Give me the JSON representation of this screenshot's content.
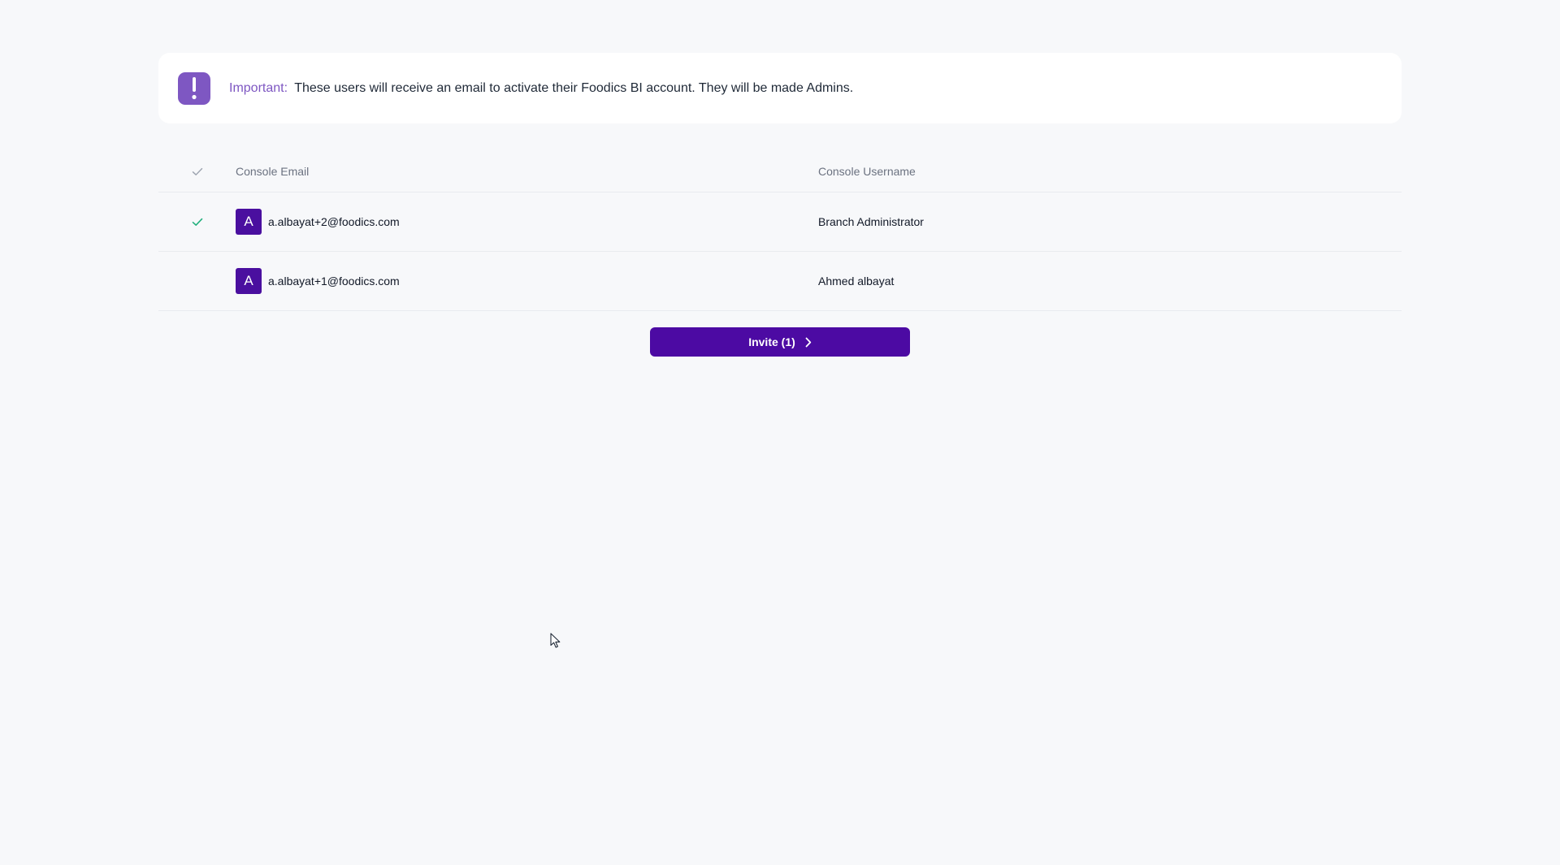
{
  "notice": {
    "icon": "exclamation-icon",
    "label": "Important:",
    "message": "These users will receive an email to activate their Foodics BI account. They will be made Admins."
  },
  "table": {
    "headers": {
      "email": "Console Email",
      "username": "Console Username"
    },
    "rows": [
      {
        "selected": true,
        "avatar_letter": "A",
        "email": "a.albayat+2@foodics.com",
        "username": "Branch Administrator"
      },
      {
        "selected": false,
        "avatar_letter": "A",
        "email": "a.albayat+1@foodics.com",
        "username": "Ahmed albayat"
      }
    ]
  },
  "invite_button": {
    "label": "Invite (1)",
    "icon": "chevron-right-icon"
  },
  "colors": {
    "accent": "#4c0aa3",
    "notice_icon_bg": "#7e57c2",
    "check_selected": "#22b07d",
    "check_header": "#9ca3af"
  }
}
